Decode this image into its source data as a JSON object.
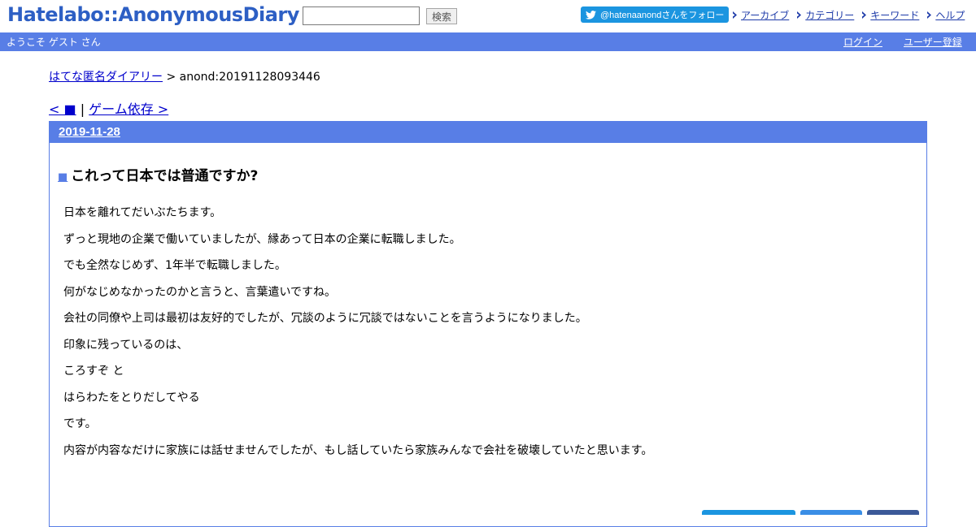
{
  "header": {
    "logo": "Hatelabo::AnonymousDiary",
    "search_placeholder": "",
    "search_button": "検索",
    "twitter_follow": "@hatenaanondさんをフォロー",
    "nav": [
      {
        "label": "アーカイブ"
      },
      {
        "label": "カテゴリー"
      },
      {
        "label": "キーワード"
      },
      {
        "label": "ヘルプ"
      }
    ]
  },
  "welcome_bar": {
    "welcome": "ようこそ ゲスト さん",
    "login": "ログイン",
    "register": "ユーザー登録"
  },
  "breadcrumb": {
    "home": "はてな匿名ダイアリー",
    "separator": " > ",
    "current": "anond:20191128093446"
  },
  "pager": {
    "prev": "< ■",
    "separator": " | ",
    "next": "ゲーム依存 >"
  },
  "entry": {
    "date": "2019-11-28",
    "marker": "■",
    "title": "これって日本では普通ですか?",
    "lines": [
      "日本を離れてだいぶたちます。",
      "ずっと現地の企業で働いていましたが、縁あって日本の企業に転職しました。",
      "でも全然なじめず、1年半で転職しました。",
      "何がなじめなかったのかと言うと、言葉遣いですね。",
      "会社の同僚や上司は最初は友好的でしたが、冗談のように冗談ではないことを言うようになりました。",
      "印象に残っているのは、",
      "ころすぞ と",
      "はらわたをとりだしてやる",
      "です。",
      "内容が内容なだけに家族には話せませんでしたが、もし話していたら家族みんなで会社を破壊していたと思います。"
    ]
  },
  "colors": {
    "accent": "#587ee6",
    "logo": "#2d5fc4",
    "twitter": "#1b95e0",
    "link": "#0000cc"
  }
}
